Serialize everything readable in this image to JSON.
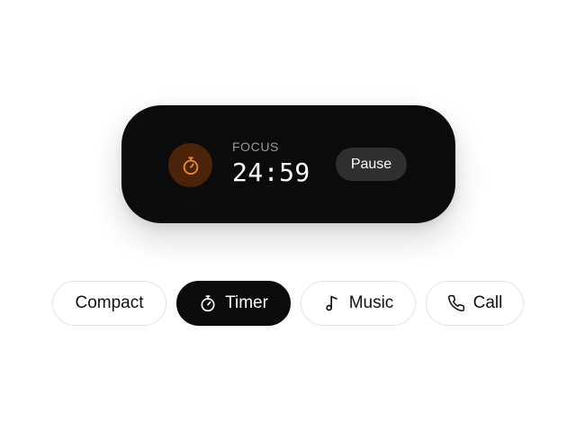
{
  "activity": {
    "label": "FOCUS",
    "time": "24:59",
    "pause_label": "Pause",
    "icon": "stopwatch-icon",
    "accent_color": "#f28c28",
    "badge_color": "#4a2308"
  },
  "modes": {
    "selected": "Timer",
    "items": [
      {
        "label": "Compact",
        "icon": null
      },
      {
        "label": "Timer",
        "icon": "stopwatch-icon"
      },
      {
        "label": "Music",
        "icon": "music-note-icon"
      },
      {
        "label": "Call",
        "icon": "phone-icon"
      }
    ]
  }
}
